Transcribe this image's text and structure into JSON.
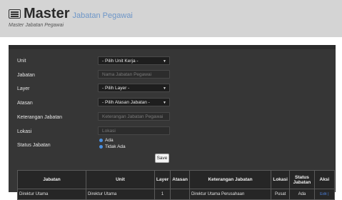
{
  "header": {
    "title": "Master",
    "subtitle": "Jabatan Pegawai",
    "breadcrumb": "Master Jabatan Pegawai"
  },
  "form": {
    "unit": {
      "label": "Unit",
      "value": "- Pilih Unit Kerja -"
    },
    "jabatan": {
      "label": "Jabatan",
      "placeholder": "Nama Jabatan Pegawai"
    },
    "layer": {
      "label": "Layer",
      "value": "- Pilih Layer -"
    },
    "atasan": {
      "label": "Atasan",
      "value": "- Pilih Atasan Jabatan -"
    },
    "keterangan": {
      "label": "Keterangan Jabatan",
      "placeholder": "Keterangan Jabatan Pegawai"
    },
    "lokasi": {
      "label": "Lokasi",
      "placeholder": "Lokasi"
    },
    "status": {
      "label": "Status Jabatan",
      "option_ada": "Ada",
      "option_tidak_ada": "Tidak Ada",
      "selected": "Ada"
    },
    "save_label": "Save"
  },
  "table": {
    "headers": [
      "Jabatan",
      "Unit",
      "Layer",
      "Atasan",
      "Keterangan Jabatan",
      "Lokasi",
      "Status Jabatan",
      "Aksi"
    ],
    "rows": [
      {
        "jabatan": "Direktur Utama",
        "unit": "Direktur Utama",
        "layer": "1",
        "atasan": "",
        "keterangan": "Direktur Utama Perusahaan",
        "lokasi": "Pusat",
        "status": "Ada",
        "aksi": "Edit |"
      }
    ]
  },
  "colors": {
    "accent": "#6d96c8",
    "panel": "#363636",
    "header": "#d4d4d4"
  }
}
